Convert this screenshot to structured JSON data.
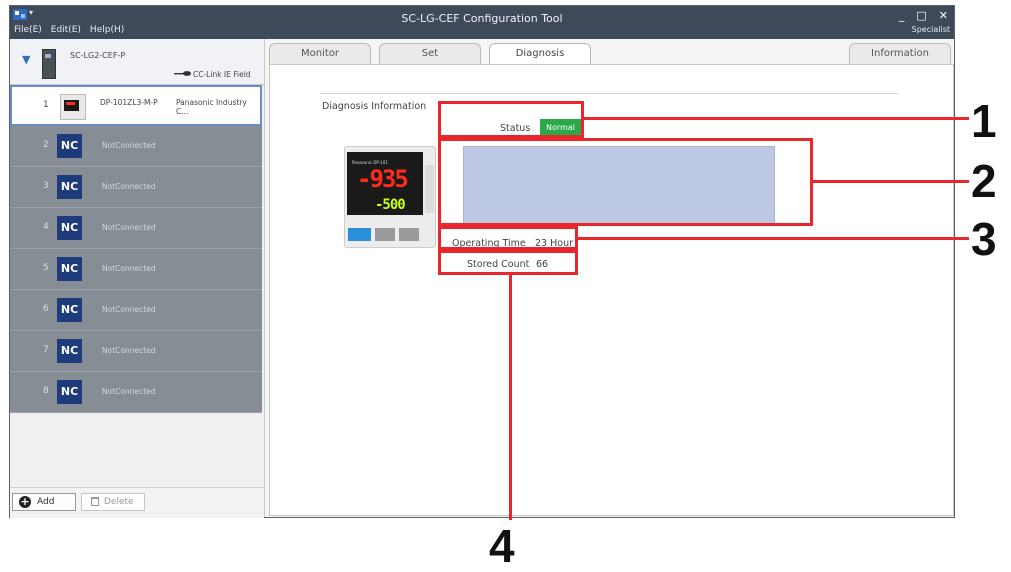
{
  "app": {
    "title": "SC-LG-CEF Configuration Tool",
    "menu": [
      "File(E)",
      "Edit(E)",
      "Help(H)"
    ],
    "mode": "Specialist",
    "window_controls": [
      "_",
      "□",
      "✕"
    ]
  },
  "tree": {
    "master_name": "SC-LG2-CEF-P",
    "network": "CC-Link IE Field",
    "selected_port": {
      "number": "1",
      "device": "DP-101ZL3-M-P",
      "vendor": "Panasonic Industry C..."
    },
    "ports": [
      {
        "number": "2",
        "badge": "NC",
        "label": "NotConnected"
      },
      {
        "number": "3",
        "badge": "NC",
        "label": "NotConnected"
      },
      {
        "number": "4",
        "badge": "NC",
        "label": "NotConnected"
      },
      {
        "number": "5",
        "badge": "NC",
        "label": "NotConnected"
      },
      {
        "number": "6",
        "badge": "NC",
        "label": "NotConnected"
      },
      {
        "number": "7",
        "badge": "NC",
        "label": "NotConnected"
      },
      {
        "number": "8",
        "badge": "NC",
        "label": "NotConnected"
      }
    ]
  },
  "buttons": {
    "add": "Add",
    "delete": "Delete"
  },
  "tabs": {
    "monitor": "Monitor",
    "set": "Set",
    "diagnosis": "Diagnosis",
    "information": "Information",
    "active": "Diagnosis"
  },
  "diagnosis": {
    "title": "Diagnosis Information",
    "status_label": "Status",
    "status_value": "Normal",
    "operating_time_label": "Operating Time",
    "operating_time_value": "23  Hour",
    "stored_count_label": "Stored Count",
    "stored_count_value": "66"
  },
  "device_image": {
    "brand": "Panasonic  DP-101",
    "main_display": "-935",
    "sub_display": "-500"
  },
  "callouts": [
    "1",
    "2",
    "3",
    "4"
  ],
  "colors": {
    "accent": "#2f6fb0",
    "status_normal": "#2ca84a",
    "callout_red": "#e8262c",
    "titlebar": "#3e4a5a",
    "nc_badge": "#1e3c7c"
  }
}
